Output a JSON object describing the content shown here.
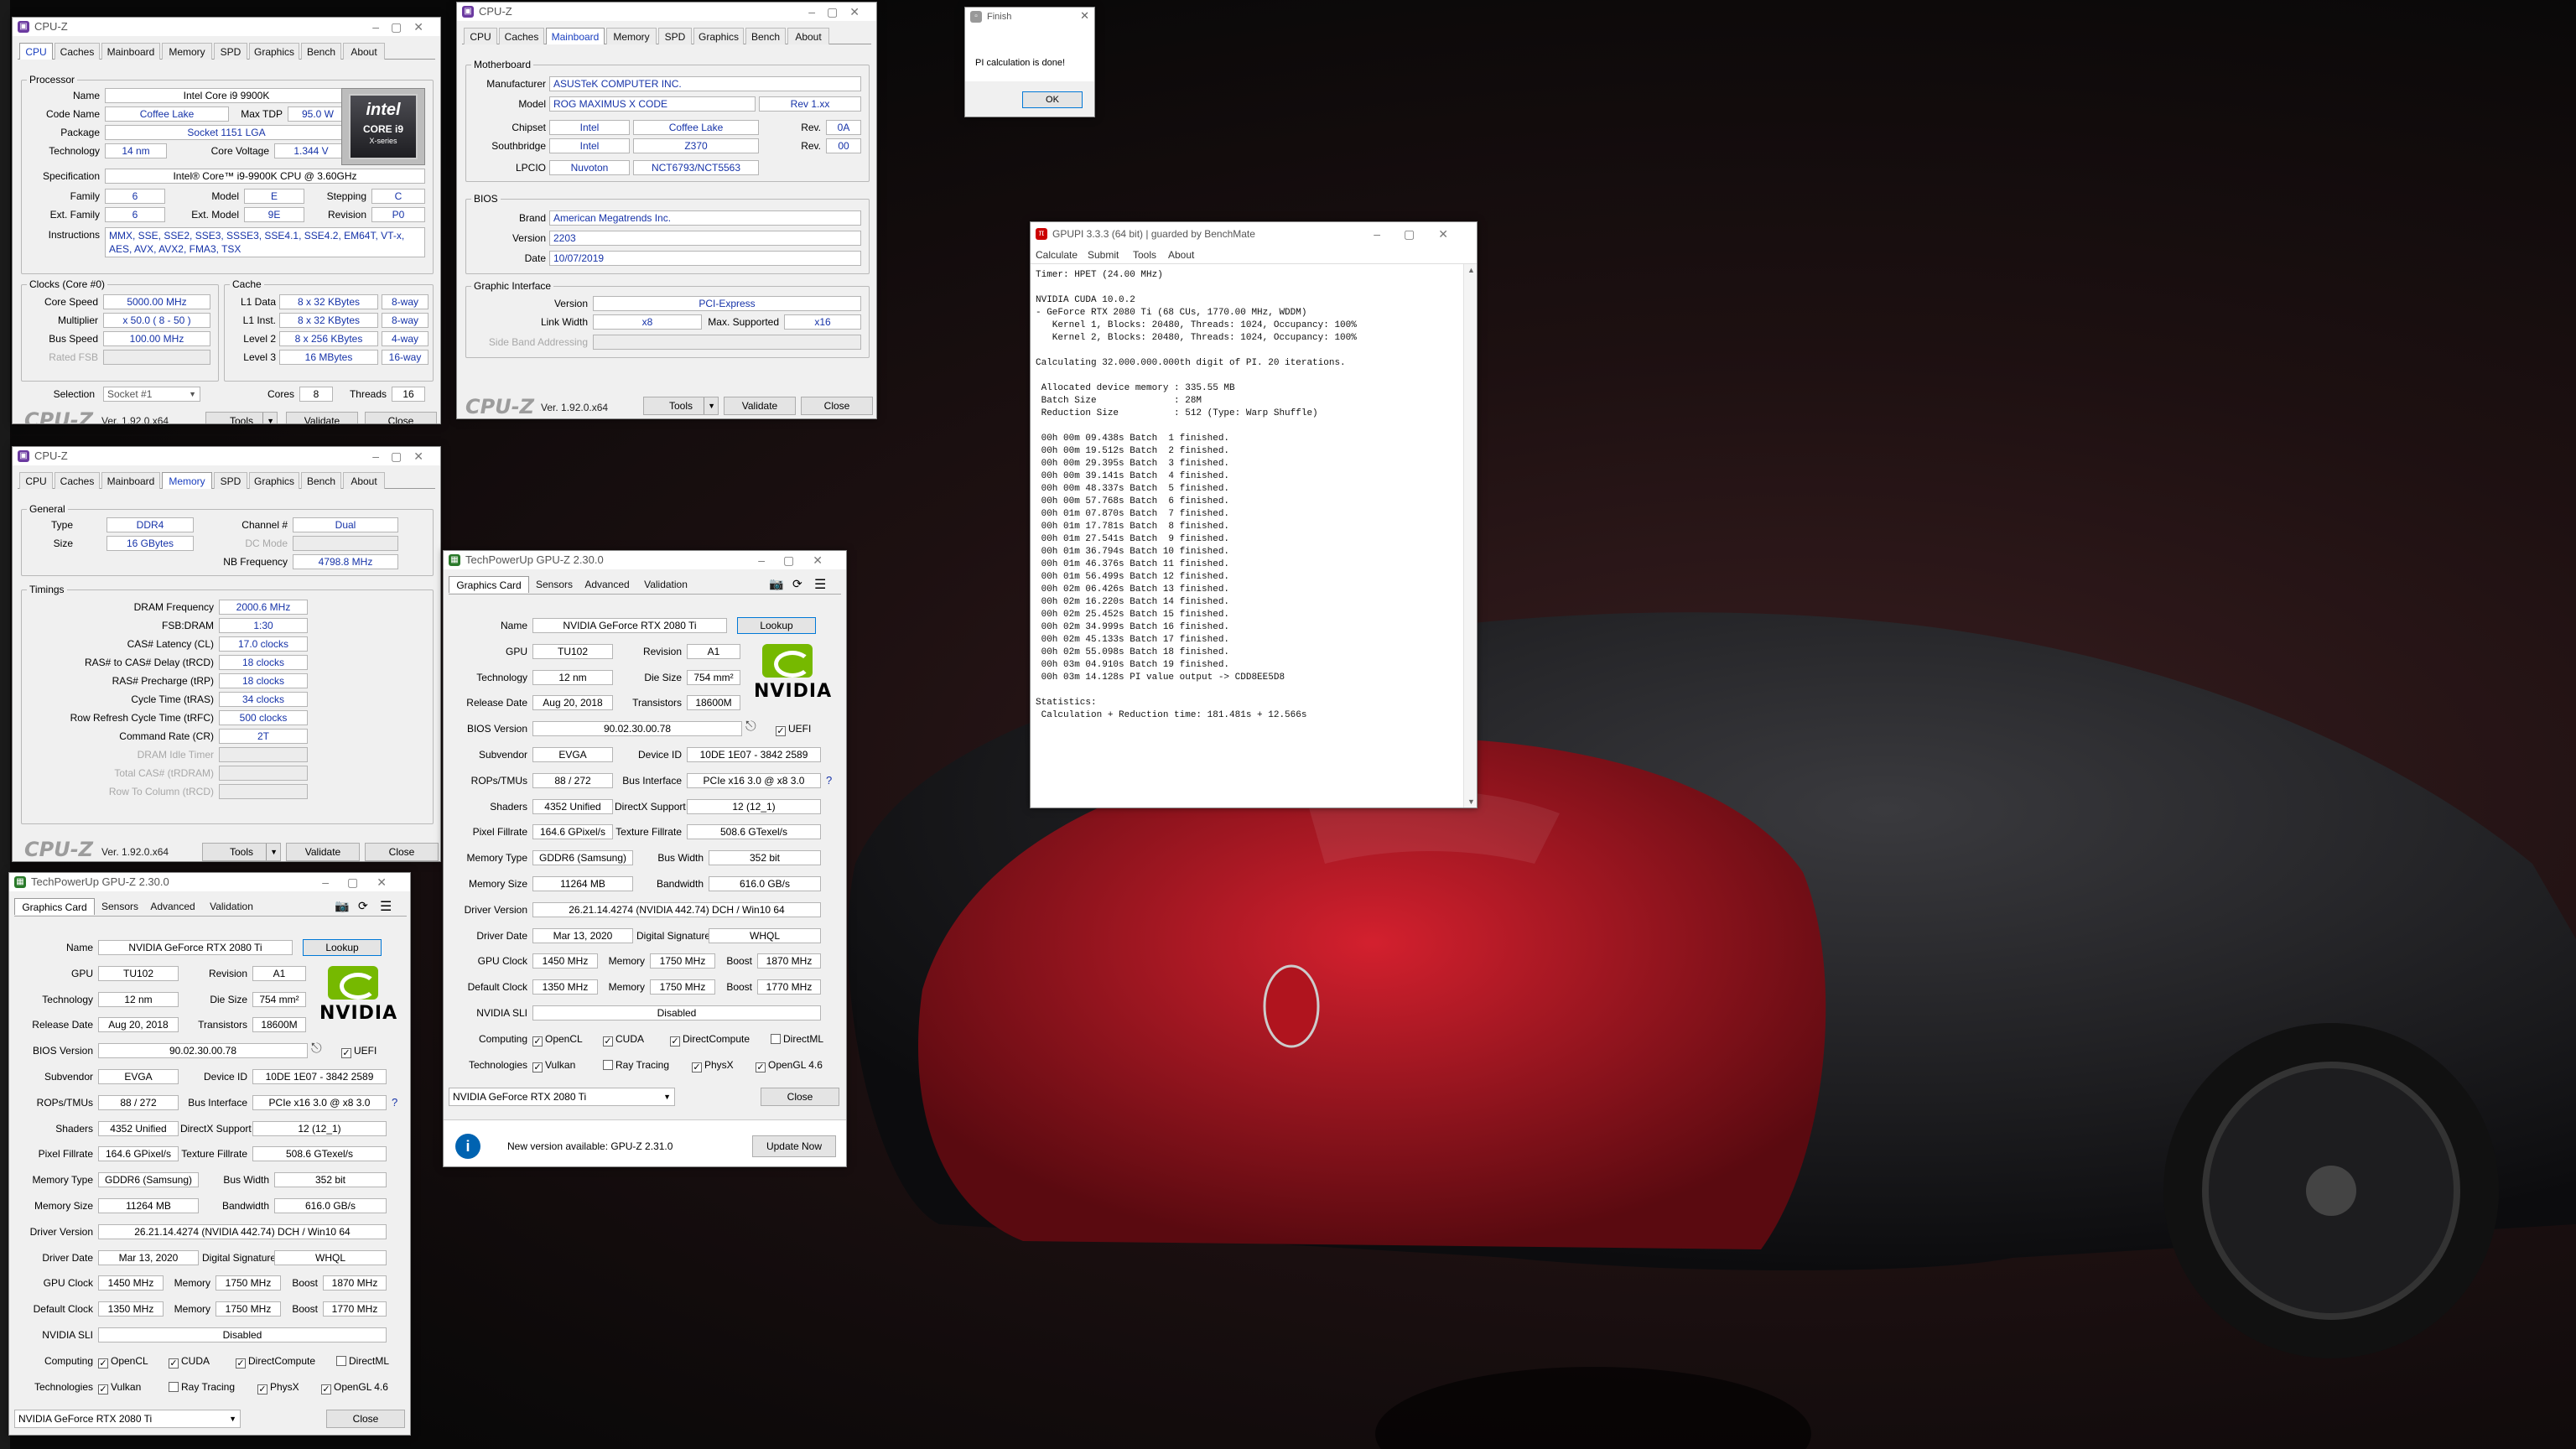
{
  "cpuz_cpu": {
    "title": "CPU-Z",
    "tabs": [
      "CPU",
      "Caches",
      "Mainboard",
      "Memory",
      "SPD",
      "Graphics",
      "Bench",
      "About"
    ],
    "processor_group": "Processor",
    "name_label": "Name",
    "name": "Intel Core i9 9900K",
    "codename_label": "Code Name",
    "codename": "Coffee Lake",
    "maxtdp_label": "Max TDP",
    "maxtdp": "95.0 W",
    "package_label": "Package",
    "package": "Socket 1151 LGA",
    "technology_label": "Technology",
    "technology": "14 nm",
    "corevoltage_label": "Core Voltage",
    "corevoltage": "1.344 V",
    "spec_label": "Specification",
    "spec": "Intel® Core™ i9-9900K CPU @ 3.60GHz",
    "family_label": "Family",
    "family": "6",
    "model_label": "Model",
    "model": "E",
    "stepping_label": "Stepping",
    "stepping": "C",
    "extfamily_label": "Ext. Family",
    "extfamily": "6",
    "extmodel_label": "Ext. Model",
    "extmodel": "9E",
    "revision_label": "Revision",
    "revision": "P0",
    "instructions_label": "Instructions",
    "instructions": "MMX, SSE, SSE2, SSE3, SSSE3, SSE4.1, SSE4.2, EM64T, VT-x, AES, AVX, AVX2, FMA3, TSX",
    "clocks_group": "Clocks (Core #0)",
    "corespeed_label": "Core Speed",
    "corespeed": "5000.00 MHz",
    "multiplier_label": "Multiplier",
    "multiplier": "x 50.0 ( 8 - 50 )",
    "busspeed_label": "Bus Speed",
    "busspeed": "100.00 MHz",
    "ratedfsb_label": "Rated FSB",
    "cache_group": "Cache",
    "l1data_label": "L1 Data",
    "l1data": "8 x 32 KBytes",
    "l1data_way": "8-way",
    "l1inst_label": "L1 Inst.",
    "l1inst": "8 x 32 KBytes",
    "l1inst_way": "8-way",
    "level2_label": "Level 2",
    "level2": "8 x 256 KBytes",
    "level2_way": "4-way",
    "level3_label": "Level 3",
    "level3": "16 MBytes",
    "level3_way": "16-way",
    "selection_label": "Selection",
    "selection": "Socket #1",
    "cores_label": "Cores",
    "cores": "8",
    "threads_label": "Threads",
    "threads": "16",
    "logo_text": "CPU-Z",
    "version": "Ver. 1.92.0.x64",
    "tools": "Tools",
    "validate": "Validate",
    "close": "Close",
    "badge_brand": "intel",
    "badge_line1": "CORE i9",
    "badge_line2": "X-series"
  },
  "cpuz_mem": {
    "title": "CPU-Z",
    "tabs": [
      "CPU",
      "Caches",
      "Mainboard",
      "Memory",
      "SPD",
      "Graphics",
      "Bench",
      "About"
    ],
    "general_group": "General",
    "type_label": "Type",
    "type": "DDR4",
    "size_label": "Size",
    "size": "16 GBytes",
    "channel_label": "Channel #",
    "channel": "Dual",
    "dcmode_label": "DC Mode",
    "nbfreq_label": "NB Frequency",
    "nbfreq": "4798.8 MHz",
    "timings_group": "Timings",
    "rows": [
      {
        "label": "DRAM Frequency",
        "value": "2000.6 MHz",
        "grey": false
      },
      {
        "label": "FSB:DRAM",
        "value": "1:30",
        "grey": false
      },
      {
        "label": "CAS# Latency (CL)",
        "value": "17.0 clocks",
        "grey": false
      },
      {
        "label": "RAS# to CAS# Delay (tRCD)",
        "value": "18 clocks",
        "grey": false
      },
      {
        "label": "RAS# Precharge (tRP)",
        "value": "18 clocks",
        "grey": false
      },
      {
        "label": "Cycle Time (tRAS)",
        "value": "34 clocks",
        "grey": false
      },
      {
        "label": "Row Refresh Cycle Time (tRFC)",
        "value": "500 clocks",
        "grey": false
      },
      {
        "label": "Command Rate (CR)",
        "value": "2T",
        "grey": false
      },
      {
        "label": "DRAM Idle Timer",
        "value": "",
        "grey": true
      },
      {
        "label": "Total CAS# (tRDRAM)",
        "value": "",
        "grey": true
      },
      {
        "label": "Row To Column (tRCD)",
        "value": "",
        "grey": true
      }
    ],
    "logo_text": "CPU-Z",
    "version": "Ver. 1.92.0.x64",
    "tools": "Tools",
    "validate": "Validate",
    "close": "Close"
  },
  "cpuz_mb": {
    "title": "CPU-Z",
    "tabs": [
      "CPU",
      "Caches",
      "Mainboard",
      "Memory",
      "SPD",
      "Graphics",
      "Bench",
      "About"
    ],
    "motherboard_group": "Motherboard",
    "manufacturer_label": "Manufacturer",
    "manufacturer": "ASUSTeK COMPUTER INC.",
    "model_label": "Model",
    "model": "ROG MAXIMUS X CODE",
    "model_rev": "Rev 1.xx",
    "chipset_label": "Chipset",
    "chipset_vendor": "Intel",
    "chipset": "Coffee Lake",
    "chipset_rev_label": "Rev.",
    "chipset_rev": "0A",
    "southbridge_label": "Southbridge",
    "sb_vendor": "Intel",
    "sb": "Z370",
    "sb_rev_label": "Rev.",
    "sb_rev": "00",
    "lpcio_label": "LPCIO",
    "lpcio_vendor": "Nuvoton",
    "lpcio": "NCT6793/NCT5563",
    "bios_group": "BIOS",
    "brand_label": "Brand",
    "brand": "American Megatrends Inc.",
    "bversion_label": "Version",
    "bversion": "2203",
    "date_label": "Date",
    "date": "10/07/2019",
    "gi_group": "Graphic Interface",
    "giversion_label": "Version",
    "giversion": "PCI-Express",
    "linkwidth_label": "Link Width",
    "linkwidth": "x8",
    "maxsupported_label": "Max. Supported",
    "maxsupported": "x16",
    "sideband_label": "Side Band Addressing",
    "logo_text": "CPU-Z",
    "version": "Ver. 1.92.0.x64",
    "tools": "Tools",
    "validate": "Validate",
    "close": "Close"
  },
  "finish": {
    "title": "Finish",
    "message": "PI calculation is done!",
    "ok": "OK"
  },
  "gpupi": {
    "title": "GPUPI 3.3.3 (64 bit) | guarded by BenchMate",
    "menu": [
      "Calculate",
      "Submit",
      "Tools",
      "About"
    ],
    "lines": [
      "Timer: HPET (24.00 MHz)",
      "",
      "NVIDIA CUDA 10.0.2",
      "- GeForce RTX 2080 Ti (68 CUs, 1770.00 MHz, WDDM)",
      "   Kernel 1, Blocks: 20480, Threads: 1024, Occupancy: 100%",
      "   Kernel 2, Blocks: 20480, Threads: 1024, Occupancy: 100%",
      "",
      "Calculating 32.000.000.000th digit of PI. 20 iterations.",
      "",
      " Allocated device memory : 335.55 MB",
      " Batch Size              : 28M",
      " Reduction Size          : 512 (Type: Warp Shuffle)",
      "",
      " 00h 00m 09.438s Batch  1 finished.",
      " 00h 00m 19.512s Batch  2 finished.",
      " 00h 00m 29.395s Batch  3 finished.",
      " 00h 00m 39.141s Batch  4 finished.",
      " 00h 00m 48.337s Batch  5 finished.",
      " 00h 00m 57.768s Batch  6 finished.",
      " 00h 01m 07.870s Batch  7 finished.",
      " 00h 01m 17.781s Batch  8 finished.",
      " 00h 01m 27.541s Batch  9 finished.",
      " 00h 01m 36.794s Batch 10 finished.",
      " 00h 01m 46.376s Batch 11 finished.",
      " 00h 01m 56.499s Batch 12 finished.",
      " 00h 02m 06.426s Batch 13 finished.",
      " 00h 02m 16.220s Batch 14 finished.",
      " 00h 02m 25.452s Batch 15 finished.",
      " 00h 02m 34.999s Batch 16 finished.",
      " 00h 02m 45.133s Batch 17 finished.",
      " 00h 02m 55.098s Batch 18 finished.",
      " 00h 03m 04.910s Batch 19 finished.",
      " 00h 03m 14.128s PI value output -> CDD8EE5D8",
      "",
      "Statistics:",
      " Calculation + Reduction time: 181.481s + 12.566s"
    ]
  },
  "gpuz1": {
    "title": "TechPowerUp GPU-Z 2.30.0",
    "tabs": [
      "Graphics Card",
      "Sensors",
      "Advanced",
      "Validation"
    ],
    "name_label": "Name",
    "name": "NVIDIA GeForce RTX 2080 Ti",
    "lookup": "Lookup",
    "gpu_label": "GPU",
    "gpu": "TU102",
    "revision_label": "Revision",
    "revision": "A1",
    "tech_label": "Technology",
    "tech": "12 nm",
    "diesize_label": "Die Size",
    "diesize": "754 mm²",
    "release_label": "Release Date",
    "release": "Aug 20, 2018",
    "transistors_label": "Transistors",
    "transistors": "18600M",
    "bios_label": "BIOS Version",
    "bios": "90.02.30.00.78",
    "uefi": "UEFI",
    "subvendor_label": "Subvendor",
    "subvendor": "EVGA",
    "deviceid_label": "Device ID",
    "deviceid": "10DE 1E07 - 3842 2589",
    "rops_label": "ROPs/TMUs",
    "rops": "88 / 272",
    "busif_label": "Bus Interface",
    "busif": "PCIe x16 3.0 @ x8 3.0",
    "shaders_label": "Shaders",
    "shaders": "4352 Unified",
    "dx_label": "DirectX Support",
    "dx": "12 (12_1)",
    "pixel_label": "Pixel Fillrate",
    "pixel": "164.6 GPixel/s",
    "texture_label": "Texture Fillrate",
    "texture": "508.6 GTexel/s",
    "memtype_label": "Memory Type",
    "memtype": "GDDR6 (Samsung)",
    "buswidth_label": "Bus Width",
    "buswidth": "352 bit",
    "memsize_label": "Memory Size",
    "memsize": "11264 MB",
    "bandwidth_label": "Bandwidth",
    "bandwidth": "616.0 GB/s",
    "driver_label": "Driver Version",
    "driver": "26.21.14.4274 (NVIDIA 442.74) DCH / Win10 64",
    "driverdate_label": "Driver Date",
    "driverdate": "Mar 13, 2020",
    "digsig_label": "Digital Signature",
    "digsig": "WHQL",
    "gpuclock_label": "GPU Clock",
    "gpuclock": "1450 MHz",
    "mem_label": "Memory",
    "mem": "1750 MHz",
    "boost_label": "Boost",
    "boost": "1870 MHz",
    "defclock_label": "Default Clock",
    "defclock": "1350 MHz",
    "defmem": "1750 MHz",
    "defboost": "1770 MHz",
    "sli_label": "NVIDIA SLI",
    "sli": "Disabled",
    "computing_label": "Computing",
    "computing": [
      "OpenCL",
      "CUDA",
      "DirectCompute",
      "DirectML"
    ],
    "technologies_label": "Technologies",
    "technologies": [
      "Vulkan",
      "Ray Tracing",
      "PhysX",
      "OpenGL 4.6"
    ],
    "select": "NVIDIA GeForce RTX 2080 Ti",
    "close": "Close",
    "update_msg": "New version available: GPU-Z 2.31.0",
    "update_btn": "Update Now",
    "nvidia": "NVIDIA"
  },
  "colors": {
    "accent_blue": "#1633a8",
    "nvidia_green": "#76b900",
    "cpuz_purple": "#6b3aa0"
  }
}
